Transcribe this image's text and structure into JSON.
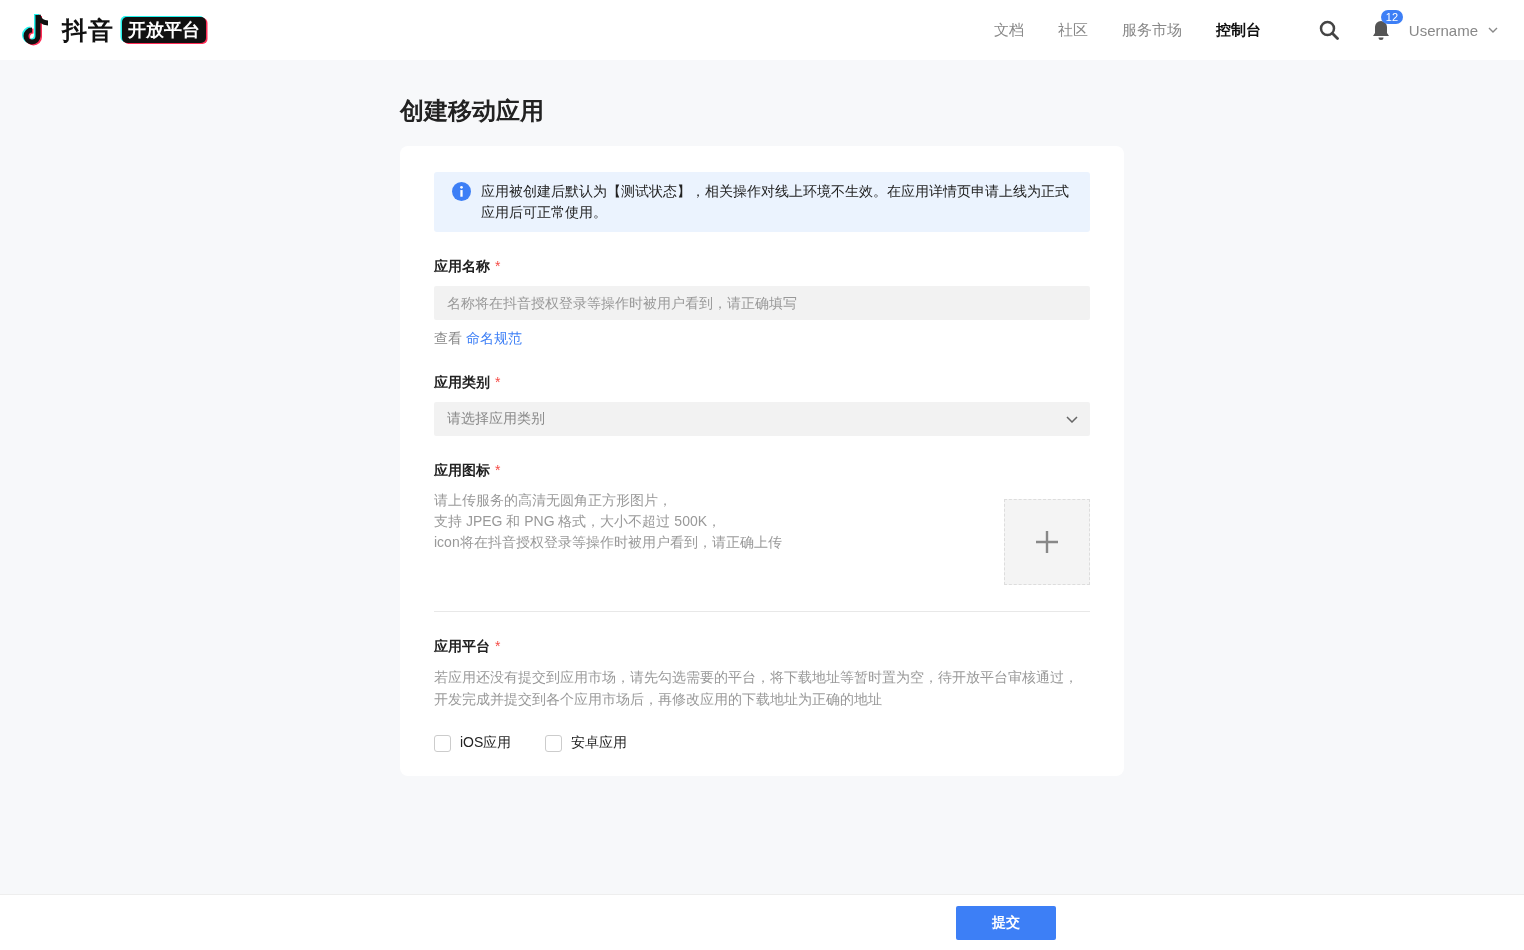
{
  "header": {
    "logo_text": "抖音",
    "logo_badge": "开放平台",
    "nav": [
      {
        "label": "文档",
        "selected": false
      },
      {
        "label": "社区",
        "selected": false
      },
      {
        "label": "服务市场",
        "selected": false
      },
      {
        "label": "控制台",
        "selected": true
      }
    ],
    "notification_count": "12",
    "username": "Username"
  },
  "page_title": "创建移动应用",
  "alert": "应用被创建后默认为【测试状态】，相关操作对线上环境不生效。在应用详情页申请上线为正式应用后可正常使用。",
  "fields": [
    {
      "kind": "text",
      "label": "应用名称",
      "required_mark": "*",
      "placeholder": "名称将在抖音授权登录等操作时被用户看到，请正确填写",
      "help_prefix": "查看",
      "help_link": "命名规范"
    },
    {
      "kind": "select",
      "label": "应用类别",
      "required_mark": "*",
      "placeholder": "请选择应用类别"
    },
    {
      "kind": "upload",
      "label": "应用图标",
      "required_mark": "*",
      "hint_lines": [
        "请上传服务的高清无圆角正方形图片，",
        "支持 JPEG 和 PNG 格式，大小不超过 500K，",
        "icon将在抖音授权登录等操作时被用户看到，请正确上传"
      ]
    },
    {
      "kind": "checkboxes",
      "label": "应用平台",
      "required_mark": "*",
      "hint": "若应用还没有提交到应用市场，请先勾选需要的平台，将下载地址等暂时置为空，待开放平台审核通过，开发完成并提交到各个应用市场后，再修改应用的下载地址为正确的地址",
      "options": [
        {
          "label": "iOS应用",
          "checked": false
        },
        {
          "label": "安卓应用",
          "checked": false
        }
      ]
    }
  ],
  "submit_button": "提交"
}
